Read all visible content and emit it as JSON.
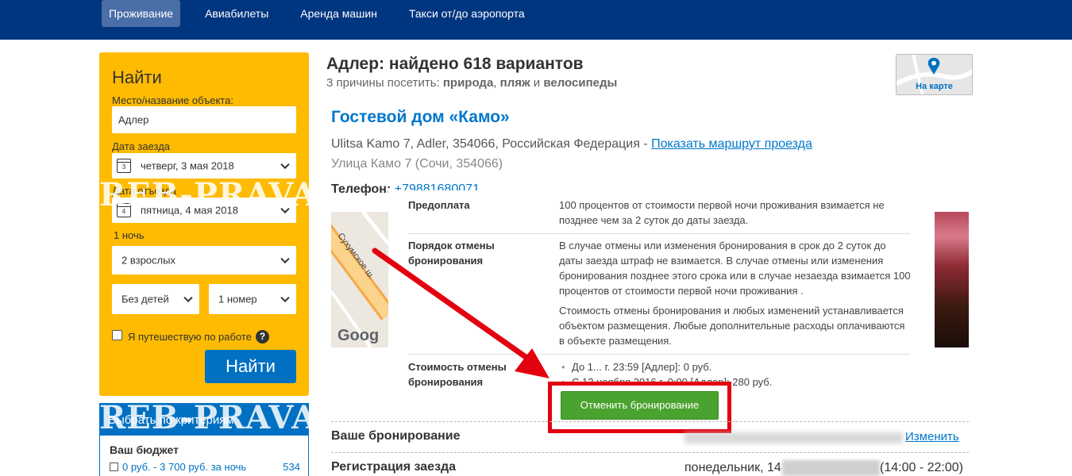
{
  "nav": {
    "tabs": [
      "Проживание",
      "Авиабилеты",
      "Аренда машин",
      "Такси от/до аэропорта"
    ]
  },
  "search": {
    "title": "Найти",
    "destination_label": "Место/название объекта:",
    "destination_value": "Адлер",
    "checkin_label": "Дата заезда",
    "checkin_day": "3",
    "checkin_value": "четверг, 3 мая 2018",
    "checkout_label": "Дата отъезда",
    "checkout_day": "4",
    "checkout_value": "пятница, 4 мая 2018",
    "nights": "1 ночь",
    "adults": "2 взрослых",
    "children": "Без детей",
    "rooms": "1 номер",
    "business_label": "Я путешествую по работе",
    "help": "?",
    "submit": "Найти"
  },
  "filters": {
    "header": "Выбрать по критериям:",
    "budget_title": "Ваш бюджет",
    "budget_option": "0 руб. - 3 700 руб. за ночь",
    "budget_count": "534"
  },
  "results": {
    "title": "Адлер: найдено 618 вариантов",
    "reasons_prefix": "3 причины посетить: ",
    "reason1": "природа",
    "sep1": ", ",
    "reason2": "пляж",
    "sep2": " и ",
    "reason3": "велосипеды",
    "map_label": "На карте"
  },
  "hotel": {
    "name": "Гостевой дом «Камо»",
    "address": "Ulitsa Kamo 7, Adler, 354066, Российская Федерация - ",
    "route_link": "Показать маршрут проезда",
    "address_local": "Улица Камо 7 (Сочи, 354066)",
    "phone_label": "Телефон: ",
    "phone": "+79881680071",
    "map_street": "Сухумское ш.",
    "map_brand": "Goog"
  },
  "policy": {
    "prepay_label": "Предоплата",
    "prepay_text": "100 процентов от стоимости первой ночи проживания взимается не позднее чем за 2 суток до даты заезда.",
    "cancel_label": "Порядок отмены бронирования",
    "cancel_text1": "В случае отмены или изменения бронирования в срок до 2 суток до даты заезда штраф не взимается. В случае отмены или изменения бронирования позднее этого срока или в случае незаезда взимается 100 процентов от стоимости первой ночи проживания .",
    "cancel_text2": "Стоимость отмены бронирования и любых изменений устанавливается объектом размещения. Любые дополнительные расходы оплачиваются в объекте размещения.",
    "cost_label": "Стоимость отмены бронирования",
    "cost_item1": "До 1... г. 23:59 [Адлер]: 0 руб.",
    "cost_item2": "С 12 ноября 2016 г. 0:00 [Адлер]: 280 руб.",
    "cancel_button": "Отменить бронирование"
  },
  "booking": {
    "your_booking_label": "Ваше бронирование",
    "change_link": "Изменить",
    "checkin_label": "Регистрация заезда",
    "checkin_day": "понедельник, 14",
    "checkin_time": "(14:00 - 22:00)"
  },
  "watermark": "REB-PRAVA",
  "colors": {
    "brand": "#003580",
    "accent": "#0071c2",
    "search_bg": "#febb02",
    "cancel_green": "#4aa32e",
    "highlight_red": "#e3000f"
  }
}
